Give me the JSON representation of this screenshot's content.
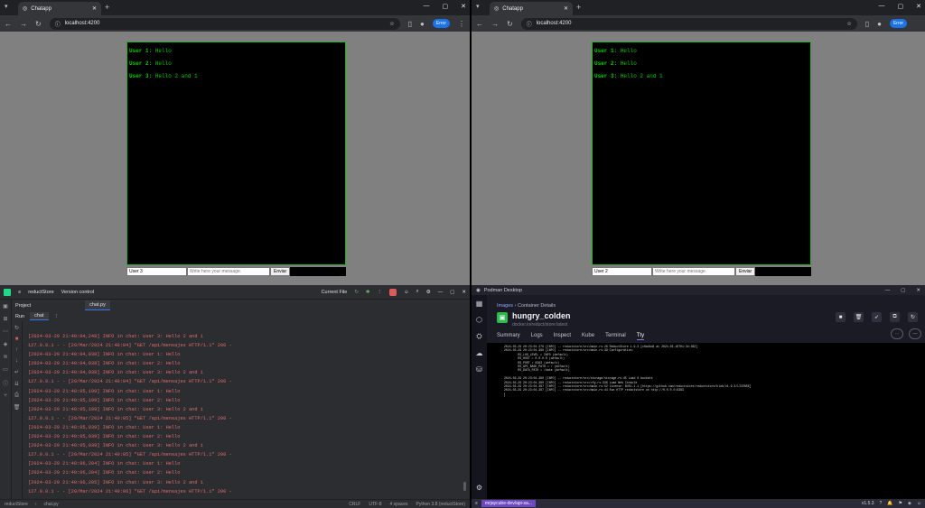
{
  "browser_left": {
    "tab_title": "Chatapp",
    "url": "localhost:4200",
    "profile_label": "Error",
    "messages": [
      {
        "user": "User 1:",
        "text": "Hello"
      },
      {
        "user": "User 2:",
        "text": "Hello"
      },
      {
        "user": "User 3:",
        "text": "Hello 2 and 1"
      }
    ],
    "user_input_value": "User 3",
    "message_placeholder": "Write here your message.",
    "send_label": "Enviar"
  },
  "browser_right": {
    "tab_title": "Chatapp",
    "url": "localhost:4200",
    "profile_label": "Error",
    "messages": [
      {
        "user": "User 1:",
        "text": "Hello"
      },
      {
        "user": "User 2:",
        "text": "Hello"
      },
      {
        "user": "User 3:",
        "text": "Hello 2 and 1"
      }
    ],
    "user_input_value": "User 2",
    "message_placeholder": "Write here your message.",
    "send_label": "Enviar"
  },
  "ide": {
    "project_name": "reductStore",
    "vcs_label": "Version control",
    "run_config": "Current File",
    "project_tab": "Project",
    "file_tab": "chat.py",
    "run_label": "Run",
    "run_tab": "chat",
    "console_lines": [
      "[2024-03-29 21:40:04,248] INFO in chat: User 3: Hello 2 and 1",
      "127.0.0.1 - - [29/Mar/2024 21:40:04] \"GET /api/mensajes HTTP/1.1\" 200 -",
      "[2024-03-29 21:40:04,938] INFO in chat: User 1: Hello",
      "[2024-03-29 21:40:04,938] INFO in chat: User 2: Hello",
      "[2024-03-29 21:40:04,938] INFO in chat: User 3: Hello 2 and 1",
      "127.0.0.1 - - [29/Mar/2024 21:40:04] \"GET /api/mensajes HTTP/1.1\" 200 -",
      "[2024-03-29 21:40:05,199] INFO in chat: User 1: Hello",
      "[2024-03-29 21:40:05,199] INFO in chat: User 2: Hello",
      "[2024-03-29 21:40:05,199] INFO in chat: User 3: Hello 2 and 1",
      "127.0.0.1 - - [29/Mar/2024 21:40:05] \"GET /api/mensajes HTTP/1.1\" 200 -",
      "[2024-03-29 21:40:05,939] INFO in chat: User 1: Hello",
      "[2024-03-29 21:40:05,939] INFO in chat: User 2: Hello",
      "[2024-03-29 21:40:05,939] INFO in chat: User 3: Hello 2 and 1",
      "127.0.0.1 - - [29/Mar/2024 21:40:05] \"GET /api/mensajes HTTP/1.1\" 200 -",
      "[2024-03-29 21:40:06,204] INFO in chat: User 1: Hello",
      "[2024-03-29 21:40:06,204] INFO in chat: User 2: Hello",
      "[2024-03-29 21:40:06,205] INFO in chat: User 3: Hello 2 and 1",
      "127.0.0.1 - - [29/Mar/2024 21:40:06] \"GET /api/mensajes HTTP/1.1\" 200 -"
    ],
    "status_path": [
      "reductStore",
      "chat.py"
    ],
    "status_right": [
      "CRLF",
      "UTF-8",
      "4 spaces",
      "Python 3.8 (reductStore)"
    ]
  },
  "podman": {
    "window_title": "Podman Desktop",
    "breadcrumb_link": "Images",
    "breadcrumb_current": "Container Details",
    "container_name": "hungry_colden",
    "image_name": "docker.io/reduct/store:latest",
    "tabs": [
      "Summary",
      "Logs",
      "Inspect",
      "Kube",
      "Terminal",
      "Tty"
    ],
    "active_tab": "Tty",
    "log_lines": [
      "2024-03-29 20:23:04.378 [INFO] -- reductstore/src/main.rs:28 ReductStore 1.9.3 [c6a4bd4 at 2024-03-16T01:34:36Z]",
      "2024-03-29 20:23:04.380 [INFO] -- reductstore/src/main.rs:39 Configuration:",
      "        RS_LOG_LEVEL = INFO (default)",
      "        RS_HOST = 0.0.0.0 (default)",
      "        RS_PORT = 8383 (default)",
      "        RS_API_BASE_PATH = / (default)",
      "        RS_DATA_PATH = /data (default)",
      "",
      "2024-03-29 20:23:04.380 [INFO] -- reductstore/src/storage/storage.rs:45 Load 0 buckets",
      "2024-03-29 20:23:04.380 [INFO] -- reductstore/src/cfg.rs:336 Load Web Console",
      "2024-03-29 20:23:04.387 [INFO] -- reductstore/src/main.rs:52 License: BUSL-1.1 [https://github.com/reductstore/reductstore/blob/v1.9.3/LICENSE]",
      "2024-03-29 20:23:04.387 [INFO] -- reductstore/src/main.rs:44 Run HTTP reductstore on http://0.0.0.0:8383"
    ],
    "branch": "mrjaycube-dev/api-sa...",
    "version": "v1.5.3"
  }
}
